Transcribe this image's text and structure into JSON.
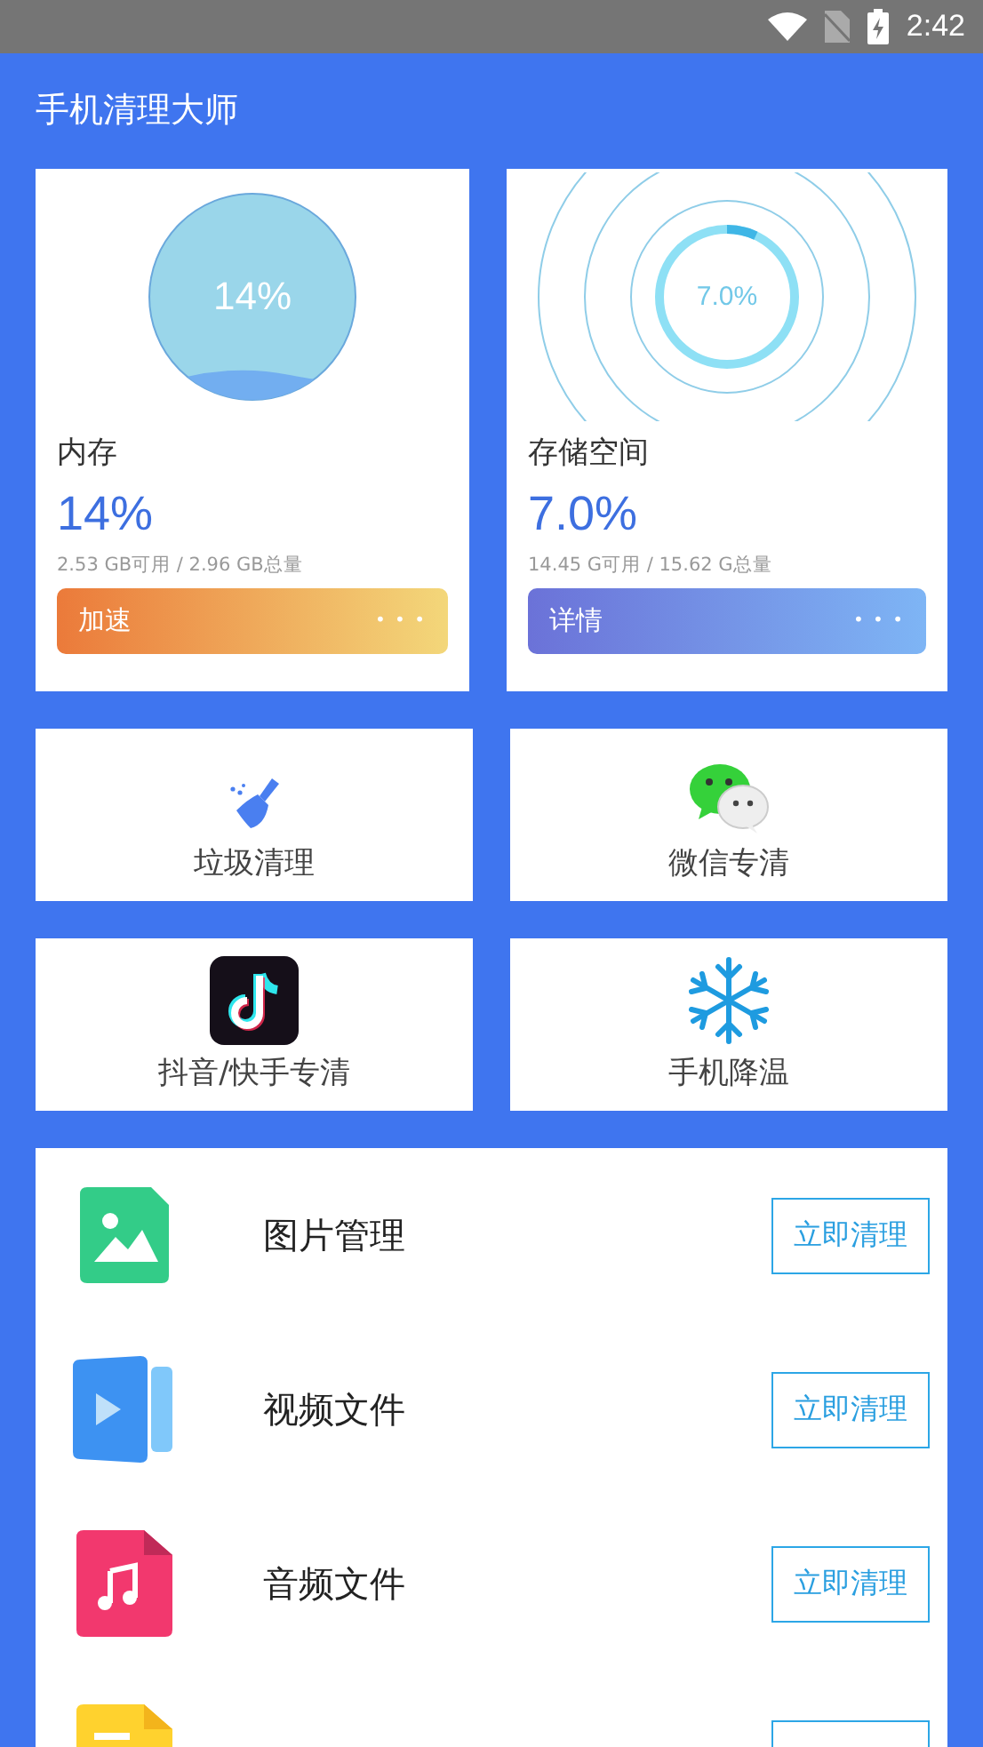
{
  "status_bar": {
    "time": "2:42"
  },
  "app_bar": {
    "title": "手机清理大师"
  },
  "cards": [
    {
      "kind": "memory",
      "gauge_text": "14%",
      "label": "内存",
      "percent": "14%",
      "detail": "2.53 GB可用 / 2.96 GB总量",
      "action": "加速",
      "more": "• • •"
    },
    {
      "kind": "storage",
      "gauge_text": "7.0%",
      "level": 0.07,
      "label": "存储空间",
      "percent": "7.0%",
      "detail": "14.45 G可用 / 15.62 G总量",
      "action": "详情",
      "more": "• • •"
    }
  ],
  "tools": [
    {
      "kind": "broom",
      "label": "垃圾清理"
    },
    {
      "kind": "chat",
      "label": "微信专清"
    },
    {
      "kind": "note",
      "label": "抖音/快手专清"
    },
    {
      "kind": "snowflake",
      "label": "手机降温"
    }
  ],
  "files": [
    {
      "kind": "image",
      "label": "图片管理",
      "button": "立即清理"
    },
    {
      "kind": "video",
      "label": "视频文件",
      "button": "立即清理"
    },
    {
      "kind": "audio",
      "label": "音频文件",
      "button": "立即清理"
    },
    {
      "kind": "document"
    }
  ]
}
